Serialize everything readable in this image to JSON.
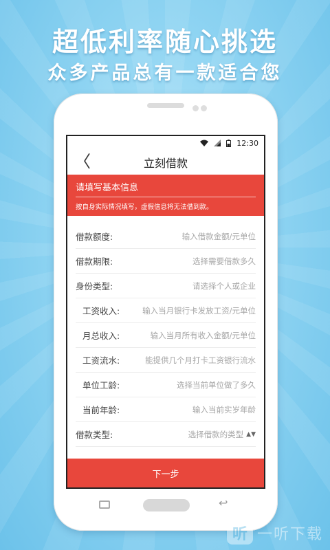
{
  "promo": {
    "headline": "超低利率随心挑选",
    "subheadline": "众多产品总有一款适合您"
  },
  "status_bar": {
    "time": "12:30",
    "icons": [
      "wifi-icon",
      "signal-icon",
      "battery-icon"
    ]
  },
  "nav": {
    "back_icon": "chevron-left-icon",
    "back_glyph": "〈",
    "title": "立刻借款"
  },
  "banner": {
    "title": "请填写基本信息",
    "subtitle": "按自身实际情况填写，虚假信息将无法借到款。"
  },
  "form": {
    "rows": [
      {
        "label": "借款额度:",
        "placeholder": "输入借款金额/元单位"
      },
      {
        "label": "借款期限:",
        "placeholder": "选择需要借款多久"
      },
      {
        "label": "身份类型:",
        "placeholder": "请选择个人或企业"
      },
      {
        "label": "工资收入:",
        "placeholder": "输入当月银行卡发放工资/元单位"
      },
      {
        "label": "月总收入:",
        "placeholder": "输入当月所有收入金额/元单位"
      },
      {
        "label": "工资流水:",
        "placeholder": "能提供几个月打卡工资银行流水"
      },
      {
        "label": "单位工龄:",
        "placeholder": "选择当前单位做了多久"
      },
      {
        "label": "当前年龄:",
        "placeholder": "输入当前实岁年龄"
      },
      {
        "label": "借款类型:",
        "placeholder": "选择借款的类型"
      }
    ],
    "select_icon": "updown-arrow-icon",
    "select_glyph": "▲▼"
  },
  "next_button": "下一步",
  "watermark": {
    "badge": "听",
    "text": "一听下载"
  },
  "colors": {
    "accent": "#e8473c",
    "background": "#8fd4f2"
  }
}
